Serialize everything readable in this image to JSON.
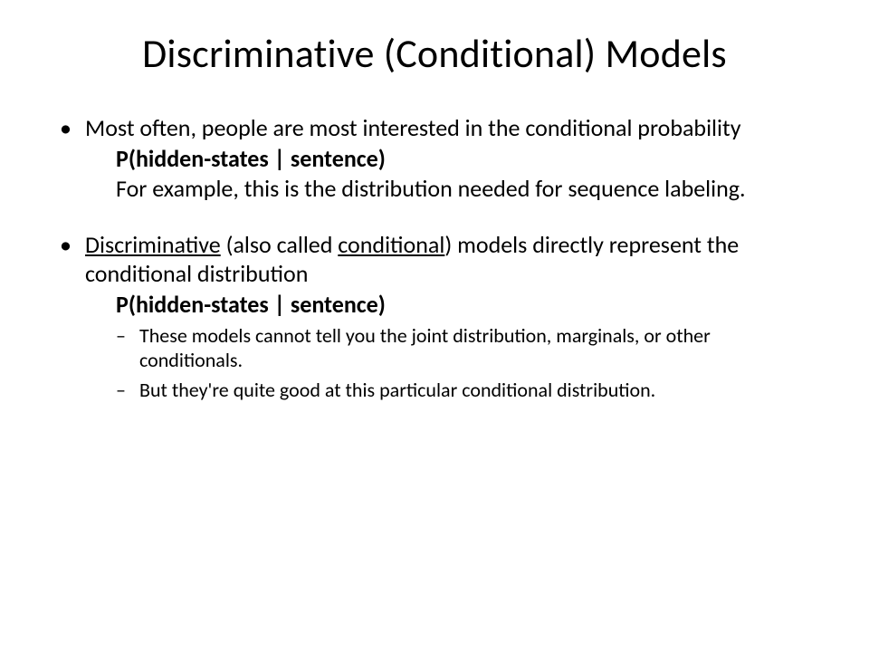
{
  "title": "Discriminative (Conditional) Models",
  "bullets": [
    {
      "lead": "Most often, people are most interested in the conditional probability",
      "formula": "P(hidden-states | sentence)",
      "followup": "For example, this is the distribution needed for sequence labeling."
    },
    {
      "lead_pre": "Discriminative",
      "lead_mid1": " (also called ",
      "lead_u2": "conditional",
      "lead_mid2": ") models directly represent the conditional distribution",
      "formula": "P(hidden-states | sentence)",
      "sub": [
        "These models cannot tell you the joint distribution, marginals, or other conditionals.",
        "But they're quite good at this particular conditional distribution."
      ]
    }
  ]
}
